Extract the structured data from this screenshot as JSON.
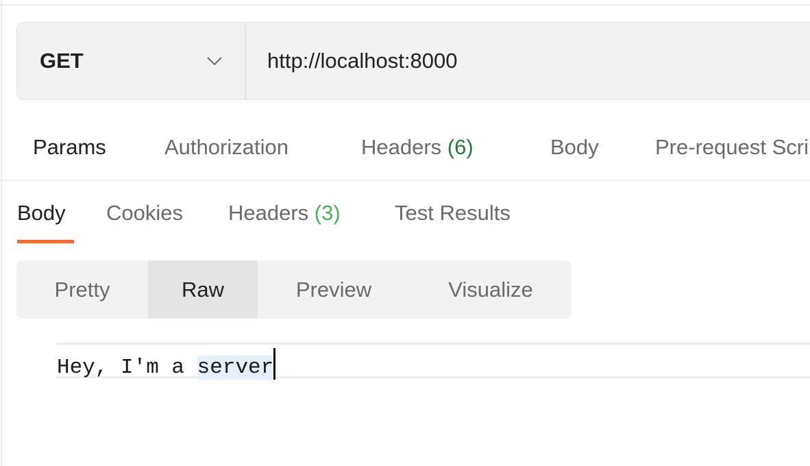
{
  "request": {
    "method": "GET",
    "url": "http://localhost:8000",
    "tabs": [
      {
        "label": "Params",
        "active": true
      },
      {
        "label": "Authorization"
      },
      {
        "label": "Headers ",
        "count": "(6)"
      },
      {
        "label": "Body"
      },
      {
        "label": "Pre-request Script"
      }
    ]
  },
  "response": {
    "tabs": [
      {
        "label": "Body",
        "active": true
      },
      {
        "label": "Cookies"
      },
      {
        "label": "Headers ",
        "count": "(3)"
      },
      {
        "label": "Test Results"
      }
    ],
    "views": [
      "Pretty",
      "Raw",
      "Preview",
      "Visualize"
    ],
    "selected_view": "Raw",
    "body_text_plain": "Hey, I'm a ",
    "body_text_selected": "server"
  },
  "colors": {
    "accent": "#f26b3a",
    "count_green": "#2b7a3b",
    "count_green_light": "#48b25a"
  }
}
